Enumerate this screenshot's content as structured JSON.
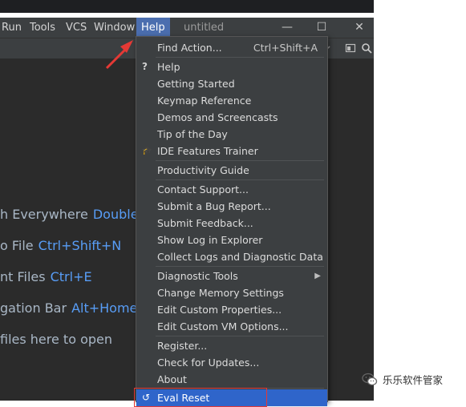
{
  "menubar": {
    "items": [
      {
        "label": "Run"
      },
      {
        "label": "Tools"
      },
      {
        "label": "VCS"
      },
      {
        "label": "Window"
      },
      {
        "label": "Help"
      }
    ],
    "title": "untitled"
  },
  "window_controls": {
    "minimize": "—",
    "maximize": "☐",
    "close": "✕"
  },
  "editor_hints": [
    {
      "text": "h Everywhere",
      "key": "Double"
    },
    {
      "text": "o File",
      "key": "Ctrl+Shift+N"
    },
    {
      "text": "nt Files",
      "key": "Ctrl+E"
    },
    {
      "text": "gation Bar",
      "key": "Alt+Home"
    },
    {
      "text": " files here to open",
      "key": ""
    }
  ],
  "help_menu": {
    "items": [
      {
        "label": "Find Action...",
        "shortcut": "Ctrl+Shift+A"
      },
      {
        "label": "Help",
        "icon": "?"
      },
      {
        "label": "Getting Started"
      },
      {
        "label": "Keymap Reference"
      },
      {
        "label": "Demos and Screencasts"
      },
      {
        "label": "Tip of the Day"
      },
      {
        "label": "IDE Features Trainer",
        "icon": "🎓"
      },
      {
        "label": "Productivity Guide"
      },
      {
        "label": "Contact Support..."
      },
      {
        "label": "Submit a Bug Report..."
      },
      {
        "label": "Submit Feedback..."
      },
      {
        "label": "Show Log in Explorer"
      },
      {
        "label": "Collect Logs and Diagnostic Data"
      },
      {
        "label": "Diagnostic Tools"
      },
      {
        "label": "Change Memory Settings"
      },
      {
        "label": "Edit Custom Properties..."
      },
      {
        "label": "Edit Custom VM Options..."
      },
      {
        "label": "Register..."
      },
      {
        "label": "Check for Updates..."
      },
      {
        "label": "About"
      },
      {
        "label": "Eval Reset",
        "icon": "↺"
      }
    ]
  },
  "watermark": {
    "text": "乐乐软件管家"
  },
  "colors": {
    "accent": "#4b6eaf",
    "highlight": "#2f65ca",
    "annotation": "#e53935"
  }
}
